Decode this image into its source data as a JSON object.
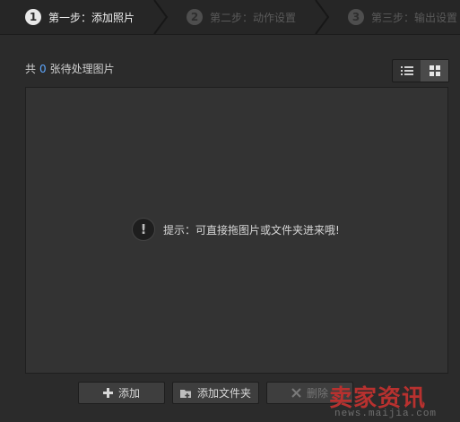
{
  "steps": [
    {
      "num": "1",
      "label": "第一步：添加照片"
    },
    {
      "num": "2",
      "label": "第二步：动作设置"
    },
    {
      "num": "3",
      "label": "第三步：输出设置"
    }
  ],
  "summary": {
    "prefix": "共",
    "count": "0",
    "suffix": "张待处理图片"
  },
  "view_toggle": {
    "list_icon": "list-icon",
    "grid_icon": "grid-icon",
    "selected": "grid"
  },
  "hint": {
    "icon": "exclamation-icon",
    "text": "提示：可直接拖图片或文件夹进来哦!"
  },
  "buttons": {
    "add": "添加",
    "add_folder": "添加文件夹",
    "delete": "删除"
  },
  "watermark": {
    "main": "卖家资讯",
    "sub": "news.maijia.com"
  },
  "colors": {
    "accent": "#5fa8ff",
    "background": "#2b2b2b",
    "watermark": "#b8312f"
  }
}
